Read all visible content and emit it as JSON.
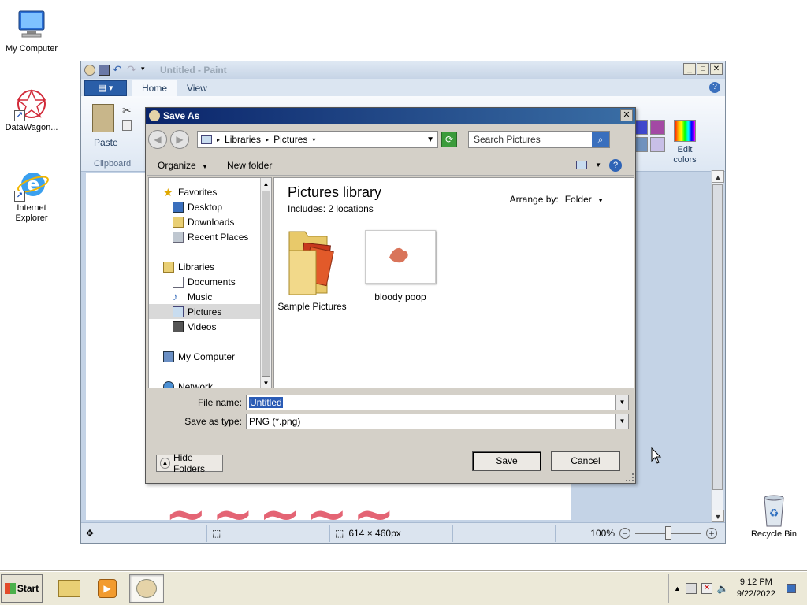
{
  "desktop": {
    "icons": [
      {
        "label": "My Computer"
      },
      {
        "label": "DataWagon..."
      },
      {
        "label": "Internet Explorer"
      },
      {
        "label": "Recycle Bin"
      }
    ]
  },
  "paint": {
    "title": "Untitled - Paint",
    "tabs": [
      "Home",
      "View"
    ],
    "clipboard": {
      "paste": "Paste",
      "group": "Clipboard"
    },
    "edit_colors": "Edit colors",
    "palette": [
      "#000000",
      "#7f7f7f",
      "#880015",
      "#ed1c24",
      "#ff7f27",
      "#fff200",
      "#22b14c",
      "#00a2e8",
      "#3f48cc",
      "#a349a4",
      "#ffffff",
      "#c3c3c3",
      "#b97a57",
      "#ffaec9",
      "#ffc90e",
      "#efe4b0",
      "#b5e61d",
      "#99d9ea",
      "#7092be",
      "#c8bfe7"
    ],
    "status": {
      "dimensions": "614 × 460px",
      "zoom": "100%"
    }
  },
  "dialog": {
    "title": "Save As",
    "breadcrumb": [
      "Libraries",
      "Pictures"
    ],
    "search_placeholder": "Search Pictures",
    "toolbar": {
      "organize": "Organize",
      "new_folder": "New folder"
    },
    "nav": {
      "favorites": "Favorites",
      "favorites_items": [
        "Desktop",
        "Downloads",
        "Recent Places"
      ],
      "libraries": "Libraries",
      "library_items": [
        "Documents",
        "Music",
        "Pictures",
        "Videos"
      ],
      "my_computer": "My Computer",
      "network": "Network"
    },
    "content": {
      "title": "Pictures library",
      "includes_label": "Includes:",
      "includes_link": "2 locations",
      "arrange_label": "Arrange by:",
      "arrange_value": "Folder",
      "items": [
        "Sample Pictures",
        "bloody poop"
      ]
    },
    "file_name_label": "File name:",
    "file_name_value": "Untitled",
    "save_type_label": "Save as type:",
    "save_type_value": "PNG (*.png)",
    "hide_folders": "Hide Folders",
    "save": "Save",
    "cancel": "Cancel"
  },
  "taskbar": {
    "start": "Start",
    "time": "9:12 PM",
    "date": "9/22/2022"
  }
}
